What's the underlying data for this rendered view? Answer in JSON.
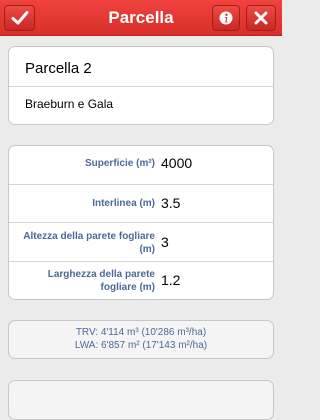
{
  "navbar": {
    "title": "Parcella",
    "confirm_icon": "checkmark-icon",
    "info_icon": "info-icon",
    "close_icon": "close-icon",
    "bar_color": "#e23834"
  },
  "parcel": {
    "name": "Parcella 2",
    "variety": "Braeburn e Gala"
  },
  "fields": [
    {
      "label": "Superficie (m²)",
      "value": "4000"
    },
    {
      "label": "Interlinea (m)",
      "value": "3.5"
    },
    {
      "label_lines": [
        "Altezza della parete fogliare",
        "(m)"
      ],
      "value": "3"
    },
    {
      "label_lines": [
        "Larghezza della parete",
        "fogliare (m)"
      ],
      "value": "1.2"
    }
  ],
  "summary": {
    "trv": "TRV: 4'114 m³ (10'286 m³/ha)",
    "lwa": "LWA: 6'857 m² (17'143 m²/ha)"
  }
}
